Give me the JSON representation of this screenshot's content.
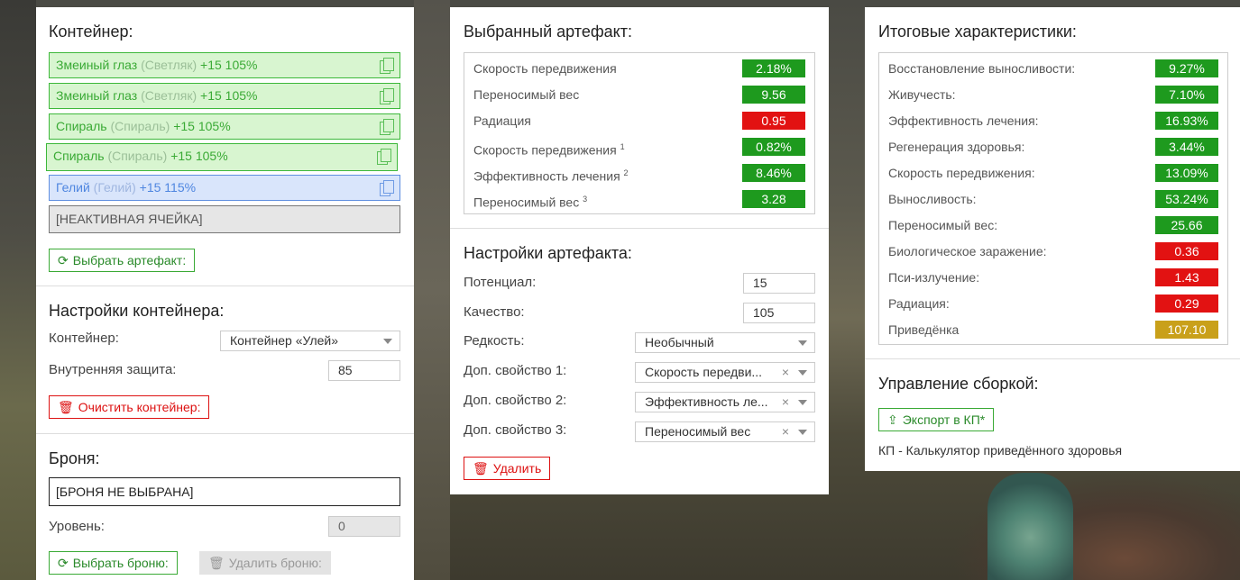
{
  "container_panel": {
    "title": "Контейнер:",
    "slots": [
      {
        "name": "Змеиный глаз",
        "sub": "(Светляк)",
        "level": "+15 105%",
        "type": "green"
      },
      {
        "name": "Змеиный глаз",
        "sub": "(Светляк)",
        "level": "+15 105%",
        "type": "green"
      },
      {
        "name": "Спираль",
        "sub": "(Спираль)",
        "level": "+15 105%",
        "type": "green"
      },
      {
        "name": "Спираль",
        "sub": "(Спираль)",
        "level": "+15 105%",
        "type": "green"
      },
      {
        "name": "Гелий",
        "sub": "(Гелий)",
        "level": "+15 115%",
        "type": "blue"
      },
      {
        "text": "[НЕАКТИВНАЯ ЯЧЕЙКА]",
        "type": "gray"
      }
    ],
    "select_artifact_label": "Выбрать артефакт:",
    "settings_title": "Настройки контейнера:",
    "container_label": "Контейнер:",
    "container_value": "Контейнер «Улей»",
    "protection_label": "Внутренняя защита:",
    "protection_value": "85",
    "clear_label": "Очистить контейнер:",
    "armor_title": "Броня:",
    "armor_value": "[БРОНЯ НЕ ВЫБРАНА]",
    "level_label": "Уровень:",
    "level_value": "0",
    "select_armor_label": "Выбрать броню:",
    "delete_armor_label": "Удалить броню:"
  },
  "artifact_panel": {
    "title": "Выбранный артефакт:",
    "stats": [
      {
        "label": "Скорость передвижения",
        "sup": "",
        "value": "2.18%",
        "color": "g"
      },
      {
        "label": "Переносимый вес",
        "sup": "",
        "value": "9.56",
        "color": "g"
      },
      {
        "label": "Радиация",
        "sup": "",
        "value": "0.95",
        "color": "r"
      },
      {
        "label": "Скорость передвижения",
        "sup": "1",
        "value": "0.82%",
        "color": "g"
      },
      {
        "label": "Эффективность лечения",
        "sup": "2",
        "value": "8.46%",
        "color": "g"
      },
      {
        "label": "Переносимый вес",
        "sup": "3",
        "value": "3.28",
        "color": "g"
      }
    ],
    "settings_title": "Настройки артефакта:",
    "potential_label": "Потенциал:",
    "potential_value": "15",
    "quality_label": "Качество:",
    "quality_value": "105",
    "rarity_label": "Редкость:",
    "rarity_value": "Необычный",
    "prop1_label": "Доп. свойство 1:",
    "prop1_value": "Скорость передви...",
    "prop2_label": "Доп. свойство 2:",
    "prop2_value": "Эффективность ле...",
    "prop3_label": "Доп. свойство 3:",
    "prop3_value": "Переносимый вес",
    "delete_label": "Удалить"
  },
  "totals_panel": {
    "title": "Итоговые характеристики:",
    "stats": [
      {
        "label": "Восстановление выносливости:",
        "value": "9.27%",
        "color": "g"
      },
      {
        "label": "Живучесть:",
        "value": "7.10%",
        "color": "g"
      },
      {
        "label": "Эффективность лечения:",
        "value": "16.93%",
        "color": "g"
      },
      {
        "label": "Регенерация здоровья:",
        "value": "3.44%",
        "color": "g"
      },
      {
        "label": "Скорость передвижения:",
        "value": "13.09%",
        "color": "g"
      },
      {
        "label": "Выносливость:",
        "value": "53.24%",
        "color": "g"
      },
      {
        "label": "Переносимый вес:",
        "value": "25.66",
        "color": "g"
      },
      {
        "label": "Биологическое заражение:",
        "value": "0.36",
        "color": "r"
      },
      {
        "label": "Пси-излучение:",
        "value": "1.43",
        "color": "r"
      },
      {
        "label": "Радиация:",
        "value": "0.29",
        "color": "r"
      },
      {
        "label": "Приведёнка",
        "value": "107.10",
        "color": "y"
      }
    ],
    "build_title": "Управление сборкой:",
    "export_label": "Экспорт в КП*",
    "note": "КП - Калькулятор приведённого здоровья"
  }
}
